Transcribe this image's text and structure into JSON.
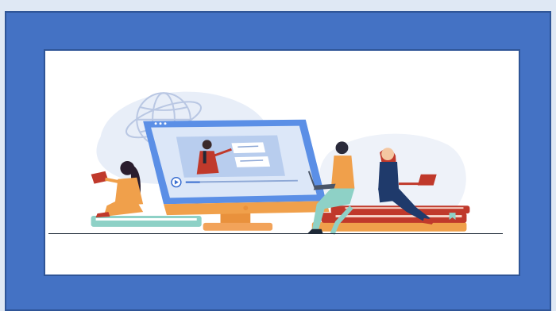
{
  "scene": {
    "description_icon": "online-learning-illustration",
    "colors": {
      "frame_blue": "#4472c4",
      "frame_border": "#2f5597",
      "panel_white": "#ffffff",
      "monitor_blue": "#5b8fe6",
      "orange": "#f0a04b",
      "red": "#c0392b",
      "navy": "#1f3a6b",
      "teal": "#8ed1c6"
    }
  }
}
